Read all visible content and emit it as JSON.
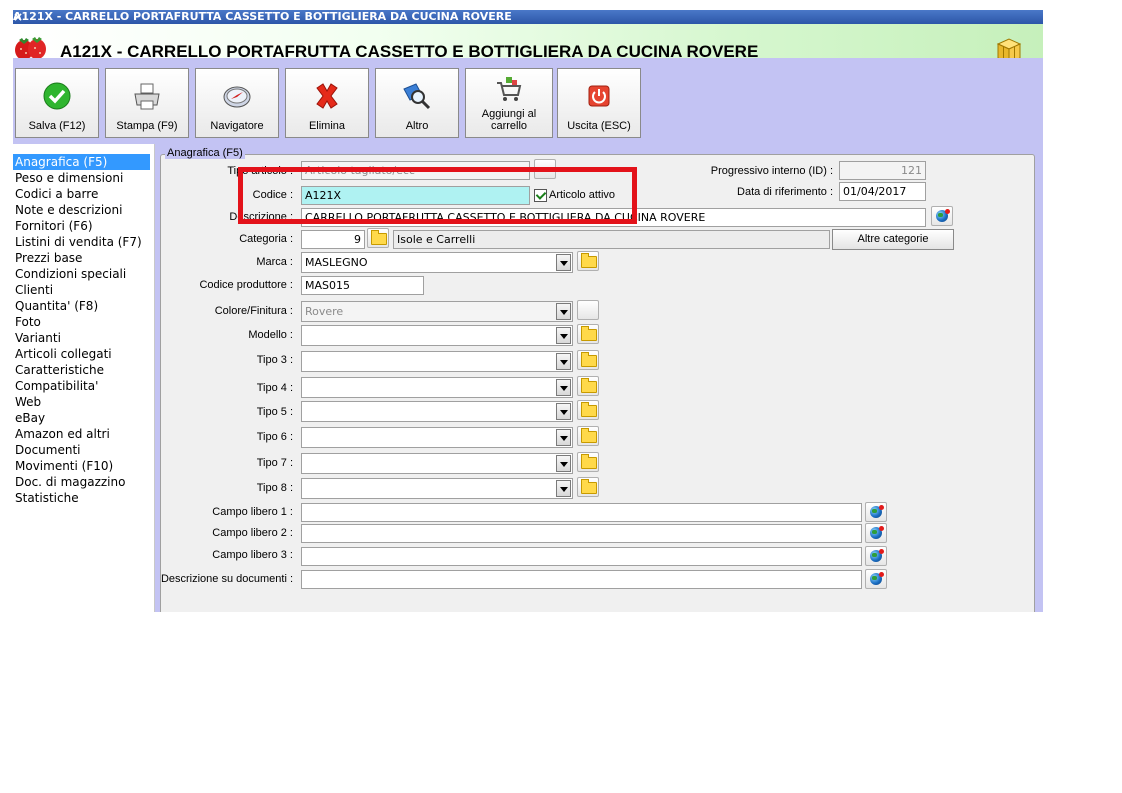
{
  "window": {
    "titlebar_text": "A121X - CARRELLO PORTAFRUTTA CASSETTO E BOTTIGLIERA DA CUCINA ROVERE",
    "close_glyph": "×",
    "header_title": "A121X - CARRELLO PORTAFRUTTA CASSETTO E BOTTIGLIERA DA CUCINA ROVERE",
    "header_icon": "strawberry-icon",
    "header_right_icon": "boxes-icon"
  },
  "toolbar": [
    {
      "label": "Salva (F12)",
      "icon": "check-icon"
    },
    {
      "label": "Stampa (F9)",
      "icon": "printer-icon"
    },
    {
      "label": "Navigatore",
      "icon": "compass-icon"
    },
    {
      "label": "Elimina",
      "icon": "red-x-icon"
    },
    {
      "label": "Altro",
      "icon": "magnifier-icon"
    },
    {
      "label": "Aggiungi al carrello",
      "icon": "cart-icon"
    },
    {
      "label": "Uscita (ESC)",
      "icon": "power-icon"
    }
  ],
  "nav": [
    "Anagrafica (F5)",
    "Peso e dimensioni",
    "Codici a barre",
    "Note e descrizioni",
    "Fornitori (F6)",
    "Listini di vendita (F7)",
    "Prezzi base",
    "Condizioni speciali",
    "Clienti",
    "Quantita' (F8)",
    "Foto",
    "Varianti",
    "Articoli collegati",
    "Caratteristiche",
    "Compatibilita'",
    "Web",
    "eBay",
    "Amazon ed altri",
    "Documenti",
    "Movimenti (F10)",
    "Doc. di magazzino",
    "Statistiche"
  ],
  "nav_selected": 0,
  "form": {
    "group_title": "Anagrafica (F5)",
    "tipo_articolo_label": "Tipo articolo :",
    "tipo_articolo_value": "Articolo tagliato/ecc",
    "codice_label": "Codice :",
    "codice_value": "A121X",
    "articolo_attivo_label": "Articolo attivo",
    "articolo_attivo_checked": true,
    "descrizione_label": "Descrizione :",
    "descrizione_value": "CARRELLO PORTAFRUTTA CASSETTO E BOTTIGLIERA DA CUCINA ROVERE",
    "progressivo_label": "Progressivo interno (ID) :",
    "progressivo_value": "121",
    "data_rif_label": "Data di riferimento :",
    "data_rif_value": "01/04/2017",
    "categoria_label": "Categoria :",
    "categoria_code": "9",
    "categoria_name": "Isole e Carrelli",
    "altre_categorie_label": "Altre categorie",
    "marca_label": "Marca :",
    "marca_value": "MASLEGNO",
    "codice_produttore_label": "Codice produttore :",
    "codice_produttore_value": "MAS015",
    "colore_label": "Colore/Finitura :",
    "colore_value": "Rovere",
    "modello_label": "Modello :",
    "tipo3_label": "Tipo 3 :",
    "tipo4_label": "Tipo 4 :",
    "tipo5_label": "Tipo 5 :",
    "tipo6_label": "Tipo 6 :",
    "tipo7_label": "Tipo 7 :",
    "tipo8_label": "Tipo 8 :",
    "campo1_label": "Campo libero 1 :",
    "campo2_label": "Campo libero 2 :",
    "campo3_label": "Campo libero 3 :",
    "desc_doc_label": "Descrizione su documenti :"
  },
  "colors": {
    "toolbar_bg": "#c3c3f3",
    "highlight_box": "#e3121a",
    "selected_nav": "#3399ff",
    "codice_field_bg": "#aff2f2"
  }
}
